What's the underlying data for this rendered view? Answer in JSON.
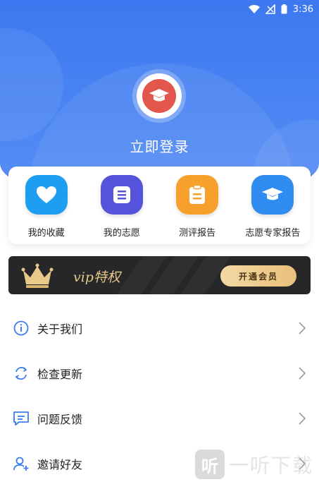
{
  "status_bar": {
    "time": "3:36"
  },
  "profile": {
    "login_label": "立即登录"
  },
  "quick_actions": [
    {
      "label": "我的收藏",
      "icon": "heart-icon",
      "color": "#1e9ef2"
    },
    {
      "label": "我的志愿",
      "icon": "list-icon",
      "color": "#5553d9"
    },
    {
      "label": "测评报告",
      "icon": "clipboard-icon",
      "color": "#f7a12c"
    },
    {
      "label": "志愿专家报告",
      "icon": "graduation-cap-icon",
      "color": "#2f8cf0"
    }
  ],
  "vip": {
    "title": "vip特权",
    "button_label": "开通会员",
    "accent": "#e7c98a"
  },
  "menu": [
    {
      "label": "关于我们",
      "icon": "info-icon"
    },
    {
      "label": "检查更新",
      "icon": "refresh-icon"
    },
    {
      "label": "问题反馈",
      "icon": "feedback-icon"
    },
    {
      "label": "邀请好友",
      "icon": "user-plus-icon"
    }
  ],
  "watermark": {
    "logo_text": "听",
    "text": "一听下载"
  },
  "colors": {
    "header_blue": "#3d78f0",
    "menu_icon_blue": "#3b7cf2"
  }
}
